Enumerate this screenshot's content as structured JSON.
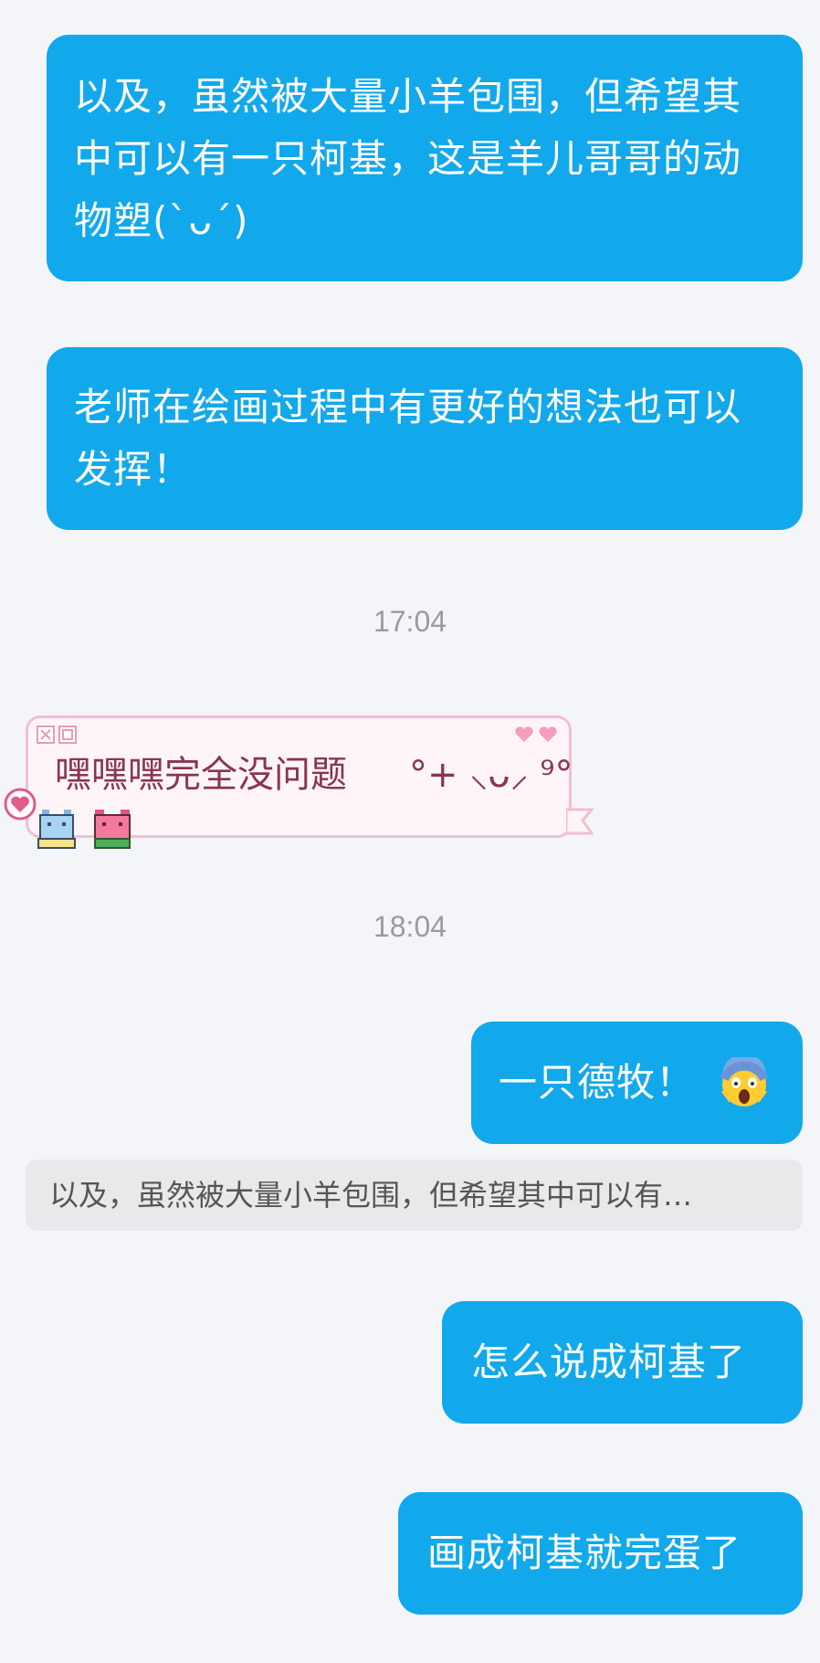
{
  "messages": [
    {
      "text": "以及，虽然被大量小羊包围，但希望其中可以有一只柯基，这是羊儿哥哥的动物塑(`ᴗ´)"
    },
    {
      "text": "老师在绘画过程中有更好的想法也可以发挥！"
    }
  ],
  "timestamps": [
    "17:04",
    "18:04"
  ],
  "reply": {
    "text": "嘿嘿嘿完全没问题",
    "kaomoji": "°+ ⸜ᴗ⸝ ⁹°",
    "icons": [
      "heart-icon",
      "pixel-cat-icon",
      "pixel-bear-icon",
      "window-buttons-icon"
    ]
  },
  "sent": [
    {
      "text": "一只德牧！",
      "emoji": "screaming-face-emoji"
    },
    {
      "text": "怎么说成柯基了"
    },
    {
      "text": "画成柯基就完蛋了"
    }
  ],
  "quote": {
    "text": "以及，虽然被大量小羊包围，但希望其中可以有…"
  },
  "colors": {
    "bubble_blue": "#12a8ec",
    "background": "#f4f5f9",
    "pink_bubble_bg": "#fff5f8",
    "pink_border": "#f1bfd0",
    "pink_text": "#8a3550",
    "timestamp": "#9a9aa0",
    "quote_bg": "#e9e9ec"
  }
}
